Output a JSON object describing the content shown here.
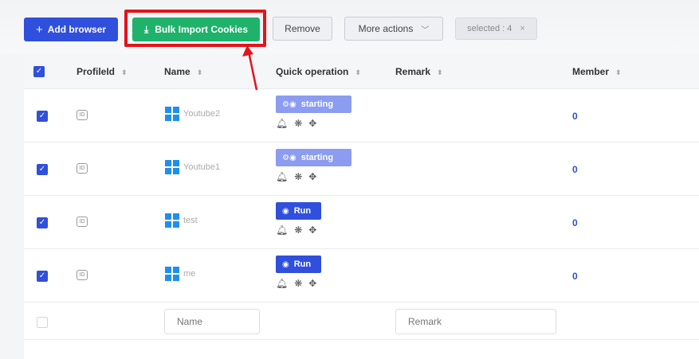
{
  "toolbar": {
    "add_browser": "Add browser",
    "bulk_import": "Bulk Import Cookies",
    "remove": "Remove",
    "more_actions": "More actions",
    "selected": "selected : 4",
    "highlight_color": "#e3141b"
  },
  "table": {
    "headers": {
      "profile_id": "ProfileId",
      "name": "Name",
      "quick_operation": "Quick operation",
      "remark": "Remark",
      "member": "Member"
    },
    "rows": [
      {
        "id_icon": "ID",
        "name": "Youtube2",
        "operation": "starting",
        "member": "0",
        "checked": true
      },
      {
        "id_icon": "ID",
        "name": "Youtube1",
        "operation": "starting",
        "member": "0",
        "checked": true
      },
      {
        "id_icon": "ID",
        "name": "test",
        "operation": "Run",
        "member": "0",
        "checked": true
      },
      {
        "id_icon": "ID",
        "name": "me",
        "operation": "Run",
        "member": "0",
        "checked": true
      }
    ],
    "filter": {
      "name_placeholder": "Name",
      "remark_placeholder": "Remark"
    }
  },
  "colors": {
    "primary": "#2f4fdc",
    "green": "#1fb26b",
    "starting": "#8c9cf0",
    "windows": "#1e8ff0"
  }
}
